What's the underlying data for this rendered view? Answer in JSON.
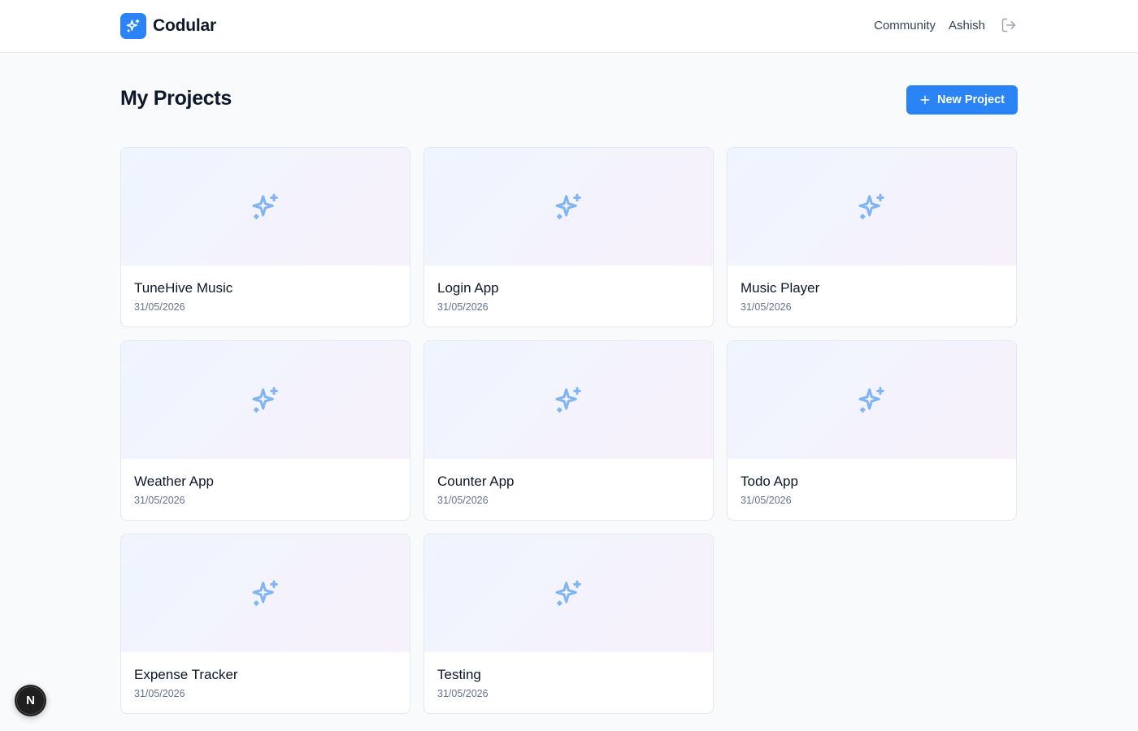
{
  "header": {
    "brand_name": "Codular",
    "brand_icon": "sparkles-icon",
    "nav": {
      "community": "Community",
      "user": "Ashish"
    },
    "logout_icon": "logout-icon"
  },
  "page": {
    "title": "My Projects",
    "new_project_label": "New Project"
  },
  "projects": [
    {
      "name": "TuneHive Music",
      "date": "31/05/2026"
    },
    {
      "name": "Login App",
      "date": "31/05/2026"
    },
    {
      "name": "Music Player",
      "date": "31/05/2026"
    },
    {
      "name": "Weather App",
      "date": "31/05/2026"
    },
    {
      "name": "Counter App",
      "date": "31/05/2026"
    },
    {
      "name": "Todo App",
      "date": "31/05/2026"
    },
    {
      "name": "Expense Tracker",
      "date": "31/05/2026"
    },
    {
      "name": "Testing",
      "date": "31/05/2026"
    }
  ],
  "dev_badge": {
    "letter": "N"
  },
  "colors": {
    "accent": "#2b84f5",
    "thumb_icon": "#7fb4f5",
    "background": "#f8fafc"
  }
}
